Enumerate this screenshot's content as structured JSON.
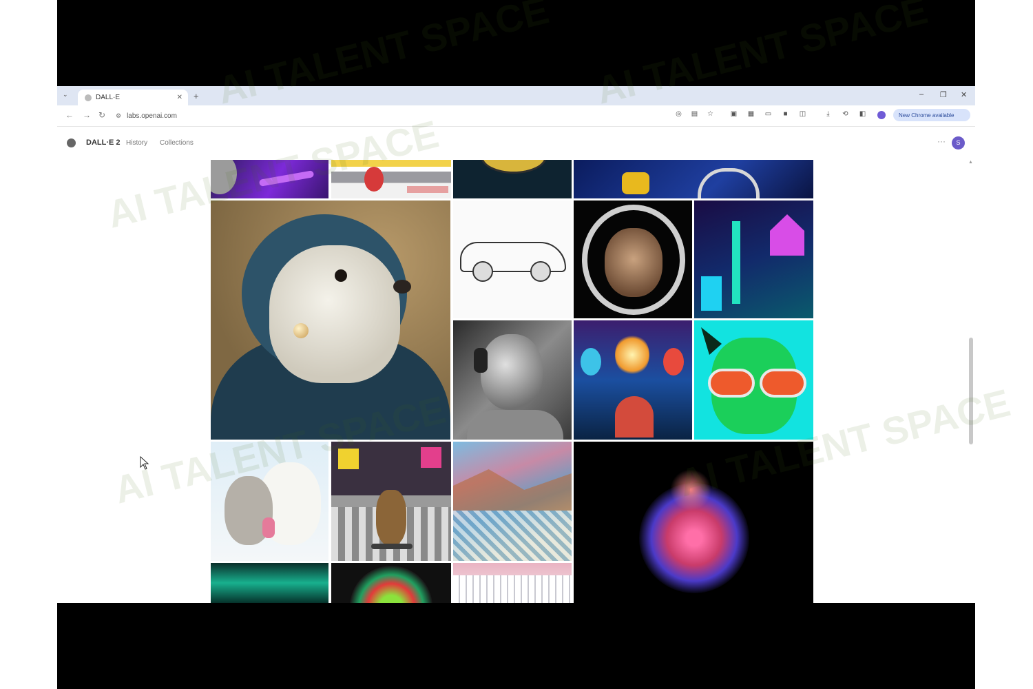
{
  "browser": {
    "tab_title": "DALL·E",
    "url": "labs.openai.com",
    "profile_label": "New Chrome available"
  },
  "site": {
    "brand": "DALL·E 2",
    "nav": [
      "History",
      "Collections"
    ],
    "avatar_initial": "S"
  },
  "watermark": "AI TALENT SPACE",
  "gallery": {
    "tiles": [
      {
        "name": "purple-planet-top",
        "subject": "space scene"
      },
      {
        "name": "astronaut-top",
        "subject": "figure"
      },
      {
        "name": "yellow-disc-top",
        "subject": "disc"
      },
      {
        "name": "blue-painting-top",
        "subject": "painting"
      },
      {
        "name": "otter-portrait",
        "subject": "otter with pearl earring"
      },
      {
        "name": "sports-car-sketch",
        "subject": "car sketch"
      },
      {
        "name": "monkey-astronaut",
        "subject": "monkey in spacesuit"
      },
      {
        "name": "neon-city",
        "subject": "neon street"
      },
      {
        "name": "statue-headphones",
        "subject": "statue with headphones"
      },
      {
        "name": "lightbulb-painting",
        "subject": "lightbulbs"
      },
      {
        "name": "pop-art-dog",
        "subject": "dog with sunglasses"
      },
      {
        "name": "cat-and-dog",
        "subject": "cat and dog"
      },
      {
        "name": "teddy-times-square",
        "subject": "teddy bear skateboarding"
      },
      {
        "name": "mosaic-river",
        "subject": "mosaic landscape"
      },
      {
        "name": "color-explosion",
        "subject": "powder explosion"
      },
      {
        "name": "teal-abstract",
        "subject": "abstract"
      },
      {
        "name": "rainbow-circle",
        "subject": "circle"
      },
      {
        "name": "pink-architecture",
        "subject": "building"
      }
    ]
  }
}
